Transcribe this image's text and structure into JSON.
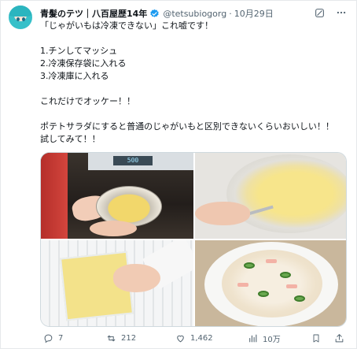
{
  "post": {
    "author": {
      "name": "青髪のテツ｜八百屋歴14年",
      "handle": "@tetsubiogorg",
      "date": "10月29日"
    },
    "text_lines": [
      "「じゃがいもは冷凍できない」これ嘘です！",
      "",
      "1.チンしてマッシュ",
      "2.冷凍保存袋に入れる",
      "3.冷凍庫に入れる",
      "",
      "これだけでオッケー！！",
      "",
      "ポテトサラダにすると普通のじゃがいもと区別できないくらいおいしい！！",
      "試してみて！！"
    ],
    "photo_display": "500",
    "stats": {
      "replies": "7",
      "reposts": "212",
      "likes": "1,462",
      "views": "10万"
    }
  },
  "colors": {
    "text": "#0f1419",
    "secondary": "#536471",
    "verified": "#1d9bf0",
    "border": "#cfd9de"
  },
  "icons": [
    "verified-badge-icon",
    "grok-icon",
    "more-icon",
    "reply-icon",
    "repost-icon",
    "like-icon",
    "views-icon",
    "bookmark-icon",
    "share-icon"
  ]
}
